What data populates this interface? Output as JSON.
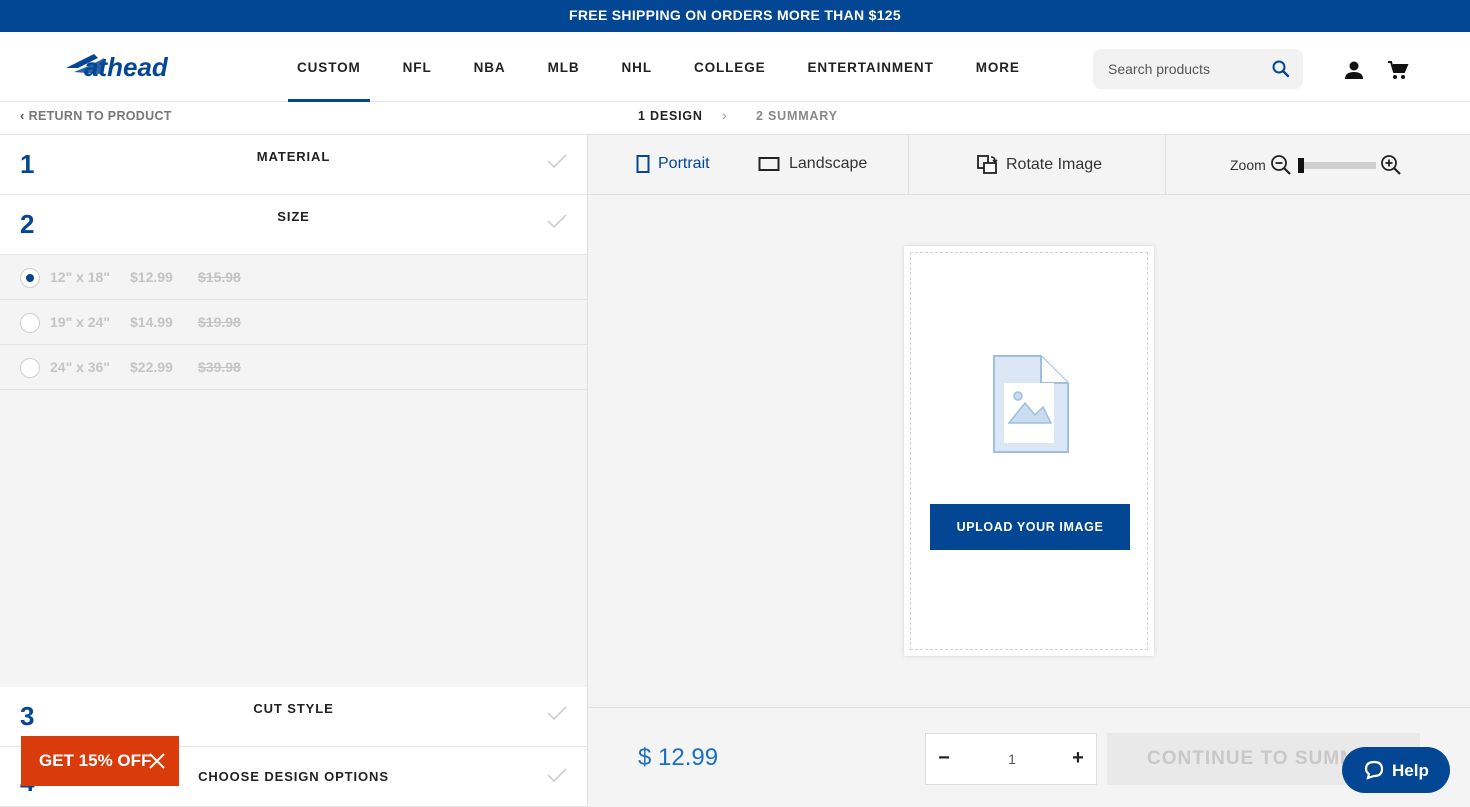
{
  "promo": {
    "text": "FREE SHIPPING ON ORDERS MORE THAN $125"
  },
  "header": {
    "logo_text": "fathead",
    "nav": [
      "CUSTOM",
      "NFL",
      "NBA",
      "MLB",
      "NHL",
      "COLLEGE",
      "ENTERTAINMENT",
      "MORE"
    ],
    "active_nav": "CUSTOM",
    "search_placeholder": "Search products",
    "icons": [
      "search-icon",
      "account-icon",
      "cart-icon"
    ]
  },
  "subbar": {
    "return_label": "RETURN TO PRODUCT",
    "step1": "1 DESIGN",
    "step2": "2 SUMMARY"
  },
  "steps": [
    {
      "num": "1",
      "title": "MATERIAL",
      "status": "complete"
    },
    {
      "num": "2",
      "title": "SIZE",
      "status": "complete"
    },
    {
      "num": "3",
      "title": "CUT STYLE",
      "status": "complete"
    },
    {
      "num": "4",
      "title": "CHOOSE DESIGN OPTIONS",
      "status": "complete"
    }
  ],
  "sizes": [
    {
      "label": "12\" x 18\"",
      "price": "$12.99",
      "old_price": "$15.98",
      "selected": true
    },
    {
      "label": "19\" x 24\"",
      "price": "$14.99",
      "old_price": "$19.98",
      "selected": false
    },
    {
      "label": "24\" x 36\"",
      "price": "$22.99",
      "old_price": "$39.98",
      "selected": false
    }
  ],
  "toolbar": {
    "portrait": "Portrait",
    "landscape": "Landscape",
    "rotate": "Rotate Image",
    "zoom_label": "Zoom",
    "zoom_level": 0,
    "orientation": "portrait"
  },
  "canvas": {
    "upload_label": "UPLOAD YOUR IMAGE"
  },
  "footer": {
    "price": "$ 12.99",
    "quantity": "1",
    "minus": "−",
    "plus": "+",
    "continue_label": "CONTINUE TO SUMMARY"
  },
  "discount": {
    "label": "GET 15% OFF"
  },
  "help": {
    "label": "Help"
  },
  "colors": {
    "brand": "#034694",
    "discount": "#d93b0b",
    "price": "#1a6fc4"
  }
}
